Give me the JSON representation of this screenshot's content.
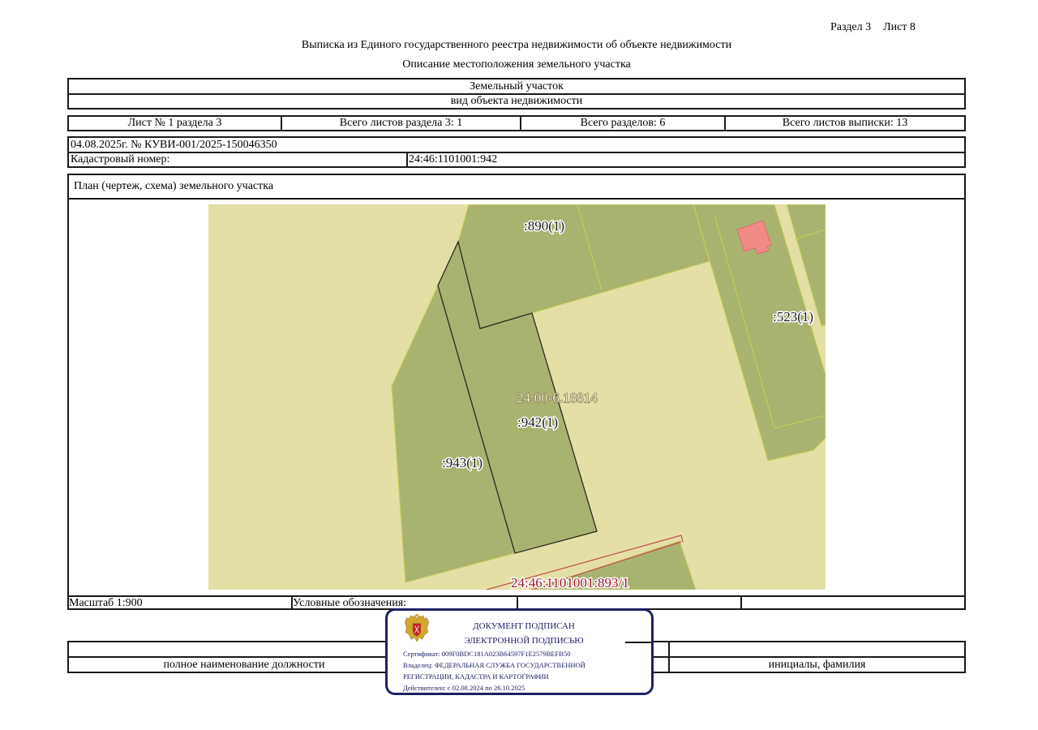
{
  "header": {
    "section": "Раздел 3",
    "sheet": "Лист 8"
  },
  "document": {
    "title": "Выписка из Единого государственного реестра недвижимости об объекте недвижимости",
    "subtitle": "Описание местоположения земельного участка"
  },
  "object": {
    "kind": "Земельный участок",
    "kind_caption": "вид объекта недвижимости"
  },
  "sheets": {
    "sheet_of_section": "Лист № 1 раздела 3",
    "section_sheets_total": "Всего листов раздела 3: 1",
    "sections_total": "Всего разделов: 6",
    "extract_sheets_total": "Всего листов выписки: 13"
  },
  "record": {
    "date_number": "04.08.2025г. № КУВИ-001/2025-150046350",
    "cadastral_label": "Кадастровый номер:",
    "cadastral_number": "24:46:1101001:942"
  },
  "plan": {
    "title": "План (чертеж, схема) земельного участка",
    "labels": {
      "parcel_890": ":890(1)",
      "parcel_523": ":523(1)",
      "quarter": "24:00-6.18814",
      "parcel_942": ":942(1)",
      "parcel_943": ":943(1)",
      "parcel_893_1": "24:46:1101001:893/1"
    },
    "colors": {
      "background": "#e4dfa5",
      "parcel": "#a9b370",
      "parcel_outline": "#c8cf55",
      "subject_outline": "#2a2a1e",
      "building": "#f28a84",
      "building_outline": "#d6706b",
      "boundary_red": "#c0504d",
      "label_red": "#9c1a30"
    }
  },
  "legend_row": {
    "scale": "Масштаб 1:900",
    "legend_label": "Условные обозначения:"
  },
  "signature": {
    "position_caption": "полное наименование должности",
    "name_caption": "инициалы, фамилия"
  },
  "stamp": {
    "heading_1": "ДОКУМЕНТ ПОДПИСАН",
    "heading_2": "ЭЛЕКТРОННОЙ ПОДПИСЬЮ",
    "certificate": "Сертификат: 009F0BDC181A023B64597F1E2579BEFB50",
    "owner_1": "Владелец: ФЕДЕРАЛЬНАЯ СЛУЖБА ГОСУДАРСТВЕННОЙ",
    "owner_2": "РЕГИСТРАЦИИ, КАДАСТРА И КАРТОГРАФИИ",
    "valid": "Действителен: с 02.08.2024 по 26.10.2025",
    "emblem": "emblem-icon",
    "color": "#1d2063"
  }
}
